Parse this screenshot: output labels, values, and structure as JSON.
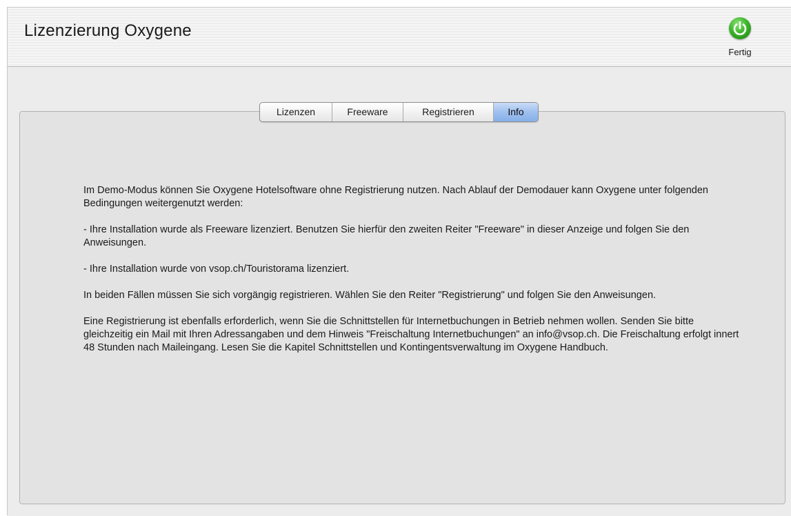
{
  "header": {
    "title": "Lizenzierung Oxygene",
    "done_label": "Fertig",
    "done_icon": "power-icon",
    "done_icon_color": "#3cb52a"
  },
  "tabs": [
    {
      "label": "Lizenzen",
      "selected": false
    },
    {
      "label": "Freeware",
      "selected": false
    },
    {
      "label": "Registrieren",
      "selected": false
    },
    {
      "label": "Info",
      "selected": true
    }
  ],
  "info": {
    "paragraphs": [
      "Im Demo-Modus können Sie Oxygene Hotelsoftware ohne Registrierung nutzen. Nach Ablauf der Demodauer kann Oxygene unter folgenden Bedingungen weitergenutzt werden:",
      "- Ihre Installation wurde als Freeware lizenziert. Benutzen Sie hierfür den zweiten Reiter \"Freeware\" in dieser Anzeige und folgen Sie den Anweisungen.",
      "- Ihre Installation wurde von vsop.ch/Touristorama lizenziert.",
      "In beiden Fällen müssen Sie sich vorgängig registrieren. Wählen Sie den Reiter \"Registrierung\" und folgen Sie den Anweisungen.",
      "Eine Registrierung ist ebenfalls erforderlich, wenn Sie die Schnittstellen für Internetbuchungen in Betrieb nehmen wollen. Senden Sie bitte gleichzeitig ein Mail mit Ihren Adressangaben und dem Hinweis \"Freischaltung Internetbuchungen\" an info@vsop.ch. Die Freischaltung erfolgt innert 48 Stunden nach Maileingang. Lesen Sie die Kapitel Schnittstellen und Kontingentsverwaltung im Oxygene Handbuch."
    ]
  },
  "colors": {
    "selected_tab": "#9fc0ee",
    "panel_background": "#e3e3e3"
  }
}
